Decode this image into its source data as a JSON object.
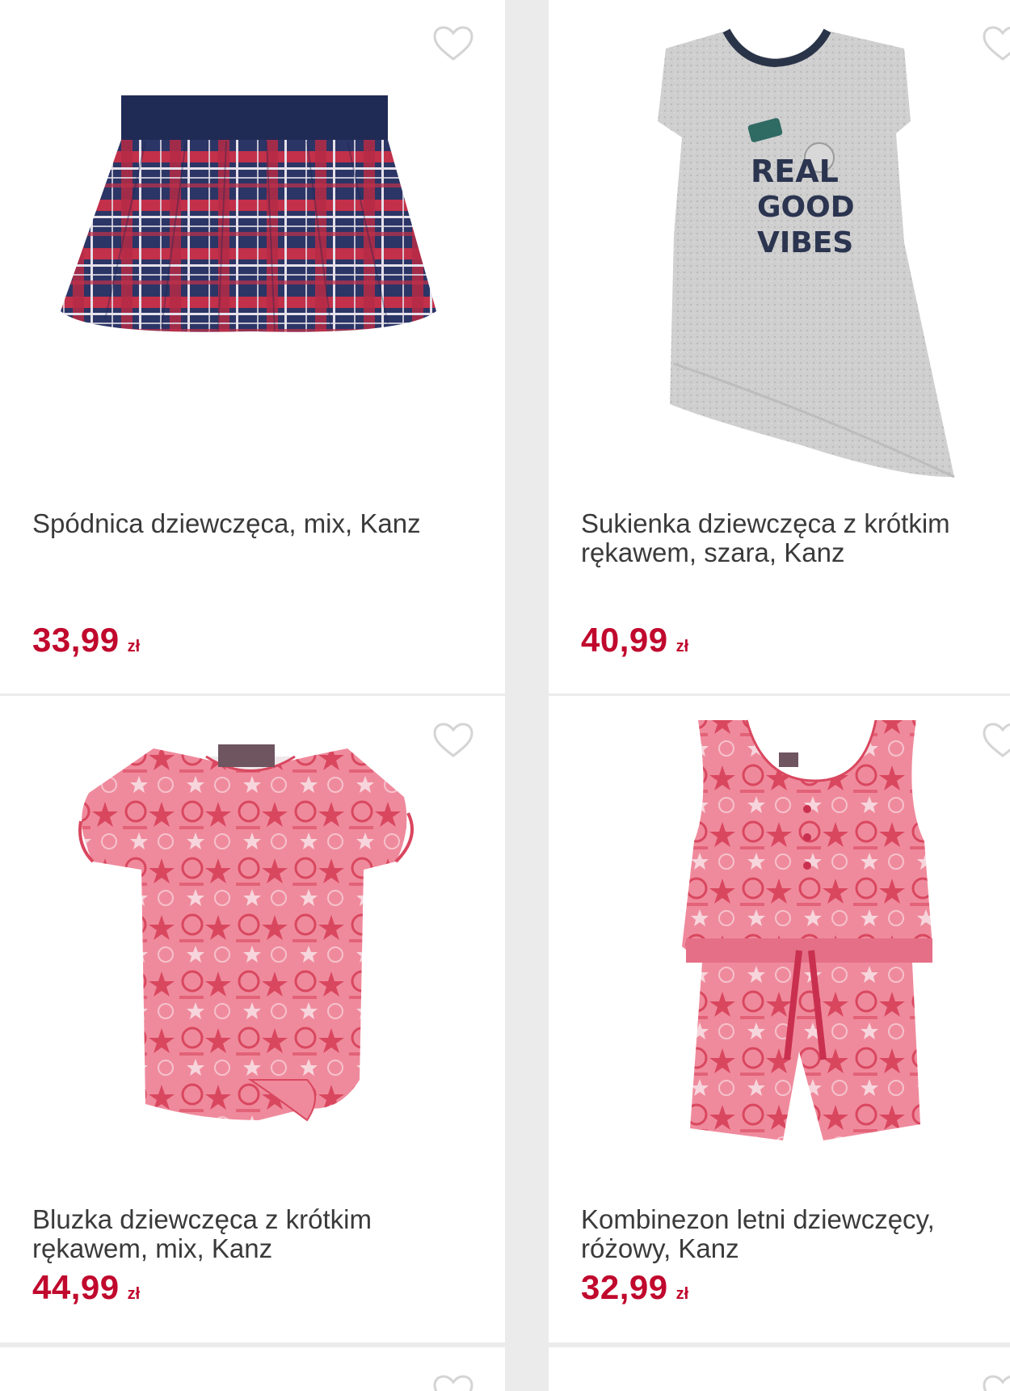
{
  "colors": {
    "background": "#ebebeb",
    "card": "#ffffff",
    "price": "#c0092d",
    "text": "#3a3a3a",
    "heart_outline": "#d4d4d4"
  },
  "products": [
    {
      "name": "Spódnica dziewczęca, mix, Kanz",
      "price": "33,99",
      "currency": "zł",
      "favorite_icon": "heart-outline-icon",
      "image": "plaid-skirt-navy-red"
    },
    {
      "name": "Sukienka dziewczęca z krótkim rękawem, szara, Kanz",
      "price": "40,99",
      "currency": "zł",
      "favorite_icon": "heart-outline-icon",
      "image": "grey-tshirt-dress",
      "image_text": [
        "REAL",
        "GOOD",
        "VIBES"
      ]
    },
    {
      "name": "Bluzka dziewczęca z krótkim rękawem, mix, Kanz",
      "price": "44,99",
      "currency": "zł",
      "favorite_icon": "heart-outline-icon",
      "image": "pink-printed-blouse"
    },
    {
      "name": "Kombinezon letni dziewczęcy, różowy, Kanz",
      "price": "32,99",
      "currency": "zł",
      "favorite_icon": "heart-outline-icon",
      "image": "pink-printed-romper"
    },
    {
      "favorite_icon": "heart-outline-icon"
    },
    {
      "favorite_icon": "heart-outline-icon"
    }
  ]
}
